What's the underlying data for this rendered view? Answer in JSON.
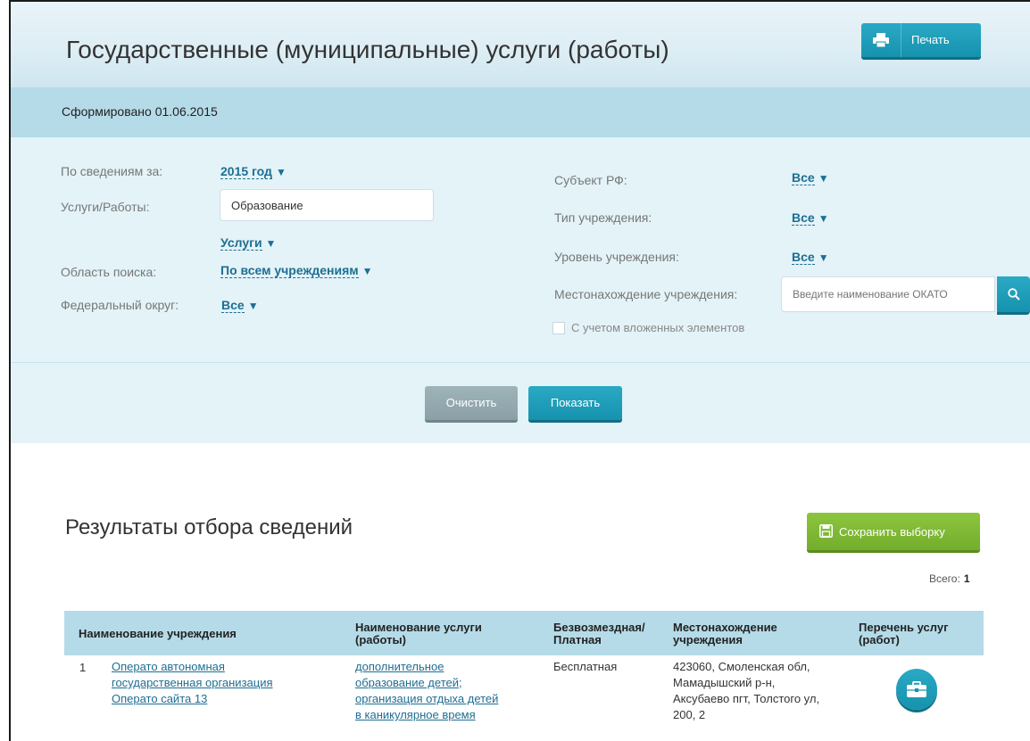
{
  "header": {
    "title": "Государственные (муниципальные) услуги (работы)",
    "print_label": "Печать"
  },
  "generated": "Сформировано 01.06.2015",
  "filters": {
    "period_label": "По сведениям за:",
    "period_value": "2015 год",
    "services_label": "Услуги/Работы:",
    "services_input": "Образование",
    "services_type": "Услуги",
    "search_area_label": "Область поиска:",
    "search_area_value": "По всем учреждениям",
    "fed_district_label": "Федеральный округ:",
    "fed_district_value": "Все",
    "subject_label": "Субъект РФ:",
    "subject_value": "Все",
    "inst_type_label": "Тип учреждения:",
    "inst_type_value": "Все",
    "inst_level_label": "Уровень учреждения:",
    "inst_level_value": "Все",
    "location_label": "Местонахождение учреждения:",
    "location_placeholder": "Введите наименование ОКАТО",
    "nested_label": "С учетом вложенных элементов",
    "nested_checked": false
  },
  "actions": {
    "clear_label": "Очистить",
    "show_label": "Показать"
  },
  "results": {
    "title": "Результаты отбора сведений",
    "save_label": "Сохранить выборку",
    "total_label": "Всего:",
    "total_value": "1",
    "columns": [
      "Наименование учреждения",
      "Наименование услуги (работы)",
      "Безвозмездная/ Платная",
      "Местонахождение учреждения",
      "Перечень услуг (работ)"
    ],
    "rows": [
      {
        "num": "1",
        "institution": [
          "Операто  автономная",
          "государственная организация",
          "Операто сайта 13"
        ],
        "service": [
          "дополнительное",
          "образование детей;",
          "организация отдыха детей",
          "в каникулярное время"
        ],
        "payment": "Бесплатная",
        "location": [
          "423060, Смоленская обл,",
          "Мамадышский р-н,",
          "Аксубаево пгт, Толстого ул,",
          "200, 2"
        ]
      }
    ]
  },
  "colors": {
    "accent": "#1a9fbd",
    "link": "#1e6e93",
    "save_green": "#7cb832",
    "header_band": "#b5dbe8",
    "filter_bg": "#e3f3f8"
  },
  "icons": {
    "print": "printer-icon",
    "search": "search-icon",
    "save": "floppy-disk-icon",
    "services_list": "briefcase-icon"
  }
}
